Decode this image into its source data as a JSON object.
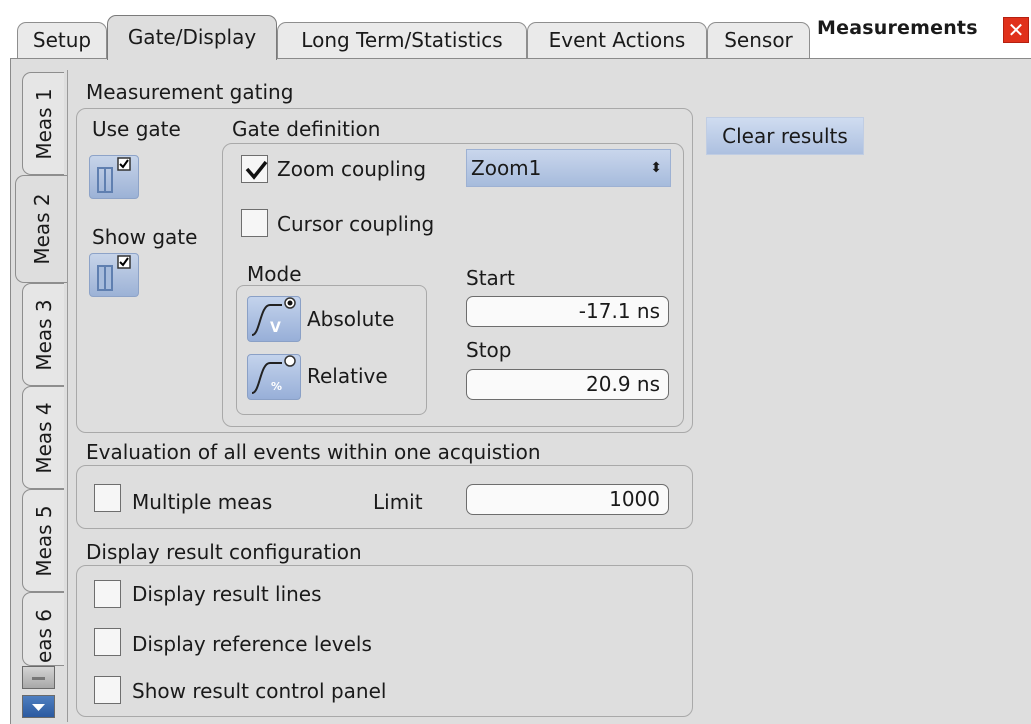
{
  "window": {
    "title": "Measurements",
    "close_icon": "close-icon"
  },
  "tabs": [
    {
      "label": "Setup",
      "active": false
    },
    {
      "label": "Gate/Display",
      "active": true
    },
    {
      "label": "Long Term/Statistics",
      "active": false
    },
    {
      "label": "Event Actions",
      "active": false
    },
    {
      "label": "Sensor",
      "active": false
    }
  ],
  "meas_tabs": [
    {
      "label": "Meas 1",
      "active": false
    },
    {
      "label": "Meas 2",
      "active": true
    },
    {
      "label": "Meas 3",
      "active": false
    },
    {
      "label": "Meas 4",
      "active": false
    },
    {
      "label": "Meas 5",
      "active": false
    },
    {
      "label": "eas 6",
      "active": false
    }
  ],
  "gating": {
    "title": "Measurement gating",
    "use_gate_label": "Use gate",
    "use_gate_checked": true,
    "show_gate_label": "Show gate",
    "show_gate_checked": true,
    "gate_definition_label": "Gate definition",
    "zoom_coupling_label": "Zoom coupling",
    "zoom_coupling_checked": true,
    "zoom_select_value": "Zoom1",
    "cursor_coupling_label": "Cursor coupling",
    "cursor_coupling_checked": false,
    "mode_label": "Mode",
    "mode_absolute_label": "Absolute",
    "mode_relative_label": "Relative",
    "mode_selected": "Absolute",
    "start_label": "Start",
    "start_value": "-17.1 ns",
    "stop_label": "Stop",
    "stop_value": "20.9 ns"
  },
  "clear_results_label": "Clear results",
  "evaluation": {
    "title": "Evaluation of all events within one acquistion",
    "multiple_meas_label": "Multiple meas",
    "multiple_meas_checked": false,
    "limit_label": "Limit",
    "limit_value": "1000"
  },
  "display_config": {
    "title": "Display result configuration",
    "items": [
      {
        "label": "Display result lines",
        "checked": false
      },
      {
        "label": "Display reference levels",
        "checked": false
      },
      {
        "label": "Show result control panel",
        "checked": false
      }
    ]
  },
  "colors": {
    "accent_blue": "#a6bbdc",
    "close_red": "#e0311b",
    "panel_gray": "#dedede"
  }
}
